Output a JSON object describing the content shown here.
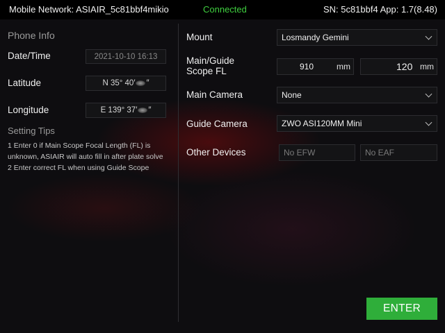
{
  "topbar": {
    "network": "Mobile Network: ASIAIR_5c81bbf4mikio",
    "status": "Connected",
    "serial": "SN: 5c81bbf4  App: 1.7(8.48)"
  },
  "phone_info": {
    "title": "Phone Info",
    "datetime_label": "Date/Time",
    "datetime_value": "2021-10-10 16:13",
    "latitude_label": "Latitude",
    "latitude_prefix": "N 35° 40′",
    "latitude_suffix": "″",
    "longitude_label": "Longitude",
    "longitude_prefix": "E 139° 37′",
    "longitude_suffix": "″"
  },
  "tips": {
    "title": "Setting Tips",
    "line1": "1 Enter 0 if Main Scope Focal Length (FL) is",
    "line2": "unknown, ASIAIR will auto fill in after plate solve",
    "line3": "2 Enter correct FL when using Guide Scope"
  },
  "settings": {
    "mount_label": "Mount",
    "mount_value": "Losmandy Gemini",
    "fl_label_1": "Main/Guide",
    "fl_label_2": "Scope FL",
    "main_fl": "910",
    "main_unit": "mm",
    "guide_fl": "120",
    "guide_unit": "mm",
    "main_camera_label": "Main Camera",
    "main_camera_value": "None",
    "guide_camera_label": "Guide Camera",
    "guide_camera_value": "ZWO ASI120MM Mini",
    "other_devices_label": "Other Devices",
    "efw_placeholder": "No EFW",
    "eaf_placeholder": "No EAF"
  },
  "enter_label": "ENTER",
  "colors": {
    "connected": "#3fcf3f",
    "enter_button": "#2fae3a"
  }
}
